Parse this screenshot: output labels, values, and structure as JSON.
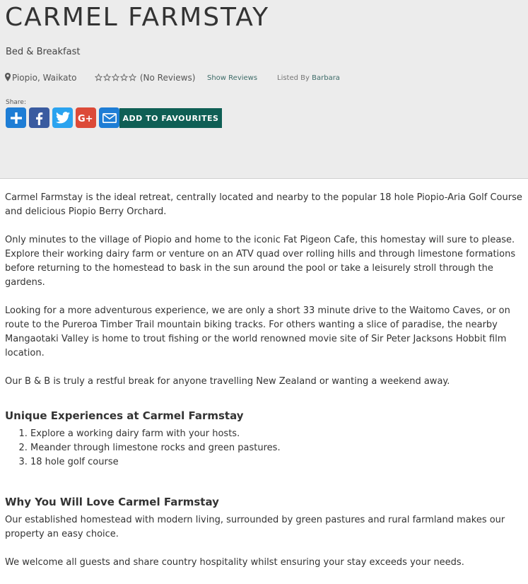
{
  "listing": {
    "title": "CARMEL FARMSTAY",
    "category": "Bed & Breakfast",
    "location": "Piopio, Waikato",
    "rating": {
      "stars_filled": 0,
      "stars_total": 5,
      "reviews_text": "(No Reviews)"
    },
    "show_reviews": "Show Reviews",
    "listed_by_label": "Listed By",
    "listed_by_name": "Barbara"
  },
  "share": {
    "label": "Share:",
    "buttons": [
      {
        "name": "add-share",
        "icon": "plus-icon",
        "color": "#1e7dd5"
      },
      {
        "name": "facebook",
        "icon": "facebook-icon",
        "color": "#3a5ba0"
      },
      {
        "name": "twitter",
        "icon": "twitter-icon",
        "color": "#2aa3ef"
      },
      {
        "name": "google-plus",
        "icon": "google-plus-icon",
        "color": "#dc4a38"
      },
      {
        "name": "email",
        "icon": "envelope-icon",
        "color": "#1e7dd5"
      }
    ],
    "favourites_label": "ADD TO FAVOURITES"
  },
  "description": {
    "paragraphs": [
      "Carmel Farmstay is the ideal retreat, centrally located and nearby to the popular 18 hole Piopio-Aria Golf Course and delicious Piopio Berry Orchard.",
      "Only minutes to the village of Piopio and home to the iconic Fat Pigeon Cafe, this homestay will sure to please. Explore their working dairy farm or venture on an ATV quad over rolling hills and through limestone formations before returning to the homestead to bask in the sun around the pool or take a leisurely stroll through the gardens.",
      "Looking for a more adventurous experience, we are only a short 33 minute drive to the Waitomo Caves, or on route to the Pureroa Timber Trail mountain biking tracks. For others wanting a slice of paradise, the nearby Mangaotaki Valley is home to trout fishing or the world renowned movie site of Sir Peter Jacksons Hobbit film location.",
      "Our B & B is truly a restful break for anyone travelling New Zealand or wanting a weekend away."
    ],
    "unique_heading": "Unique Experiences at Carmel Farmstay",
    "unique_items": [
      "Explore a working dairy farm with your hosts.",
      "Meander through limestone rocks and green pastures.",
      "18 hole golf course"
    ],
    "love_heading": "Why You Will Love Carmel Farmstay",
    "love_paragraphs": [
      "Our established homestead with modern living, surrounded by green pastures and rural farmland makes our property an easy choice.",
      "We welcome all guests and share country hospitality whilst ensuring your stay exceeds your needs."
    ]
  }
}
